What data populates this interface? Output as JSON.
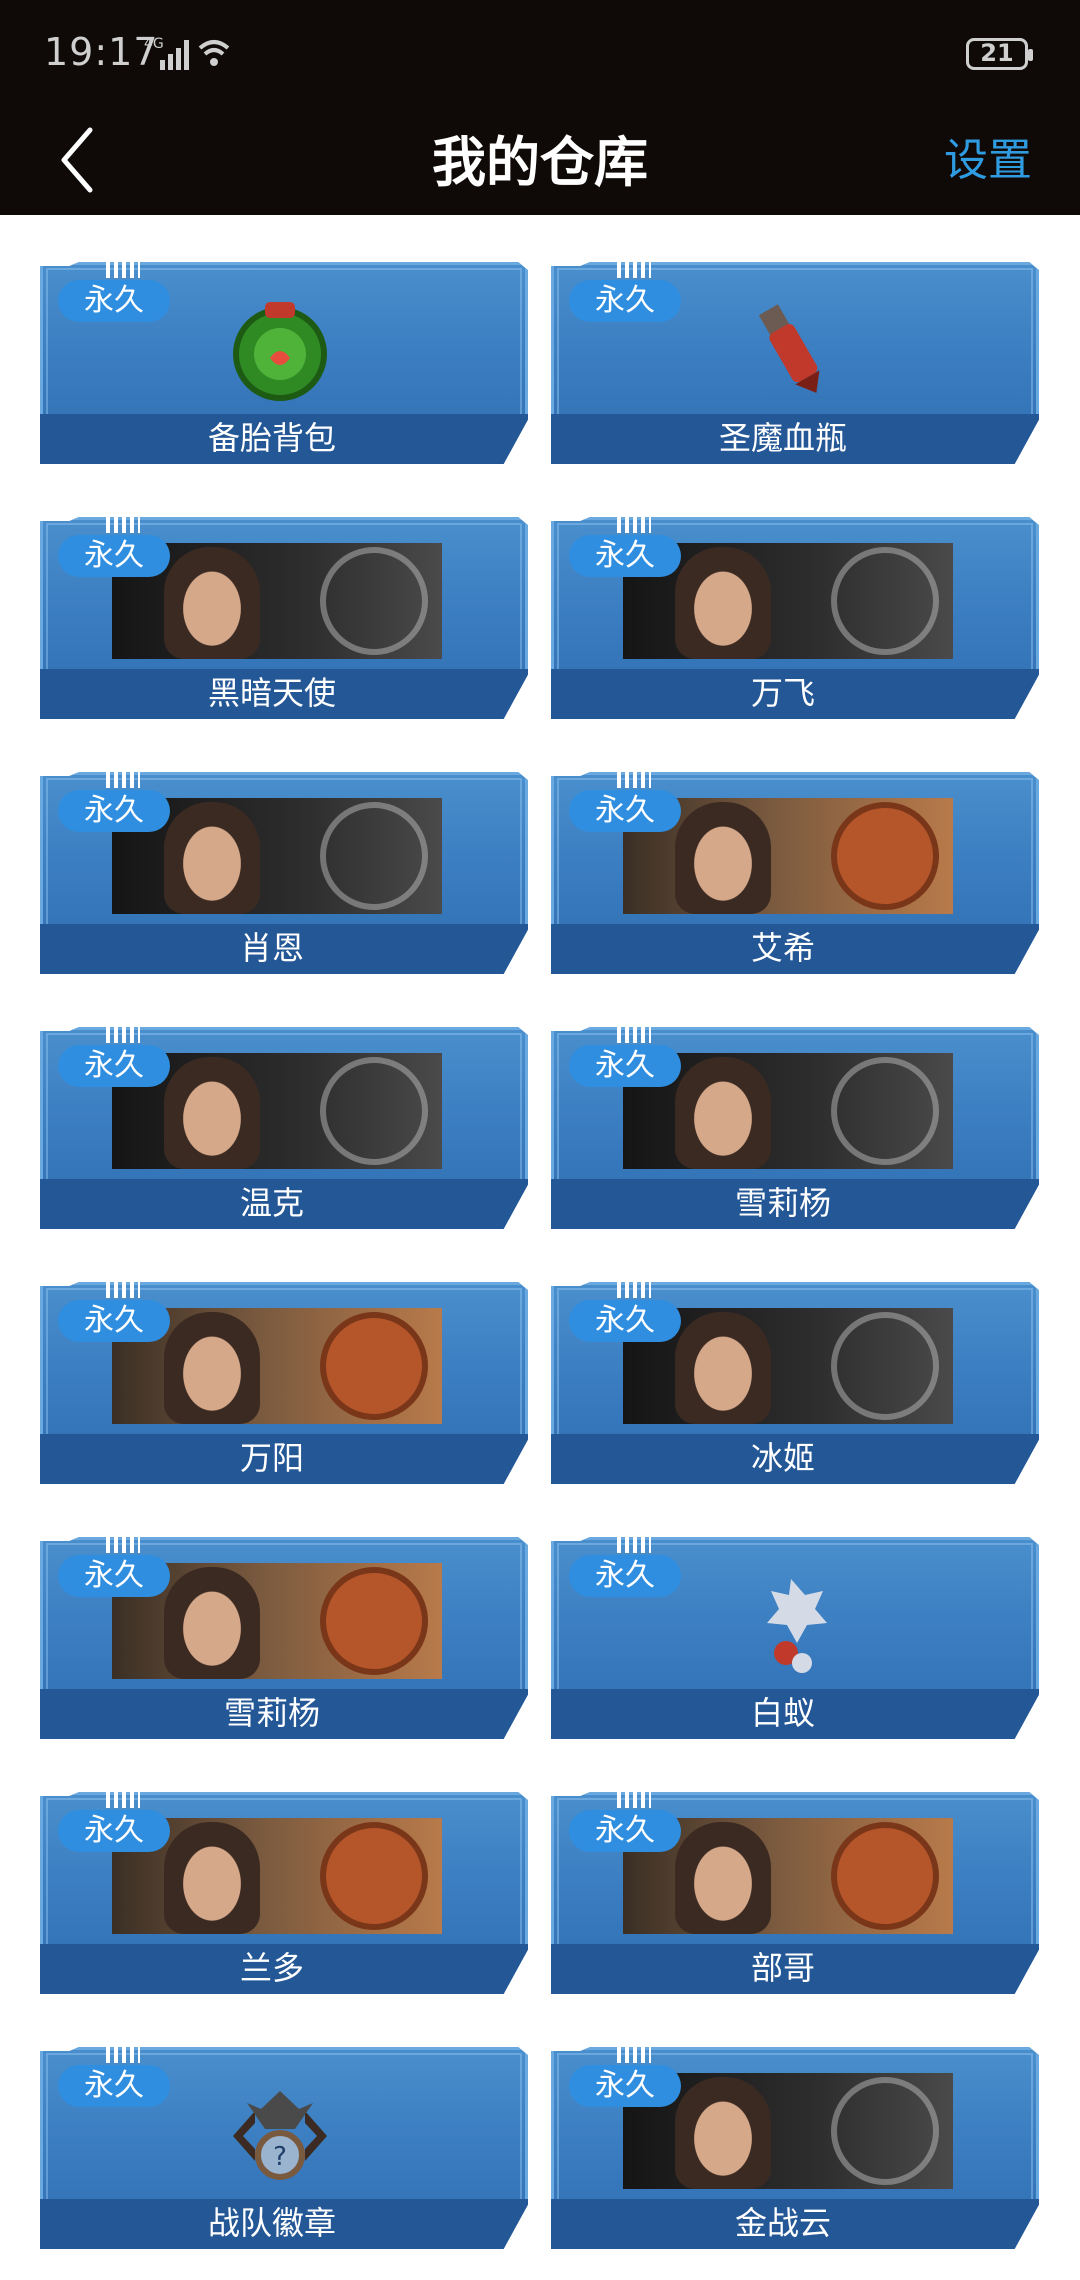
{
  "status_bar": {
    "time": "19:17",
    "network": "4G",
    "battery": "21"
  },
  "header": {
    "title": "我的仓库",
    "settings_label": "设置"
  },
  "colors": {
    "accent": "#2f9be0",
    "badge": "#2f8ee0",
    "card_blue": "#3b7ec1"
  },
  "items": [
    {
      "badge": "永久",
      "name": "备胎背包",
      "art": "green-bag-icon"
    },
    {
      "badge": "永久",
      "name": "圣魔血瓶",
      "art": "blood-vial-icon"
    },
    {
      "badge": "永久",
      "name": "黑暗天使",
      "art": "character-portrait"
    },
    {
      "badge": "永久",
      "name": "万飞",
      "art": "character-portrait"
    },
    {
      "badge": "永久",
      "name": "肖恩",
      "art": "character-portrait"
    },
    {
      "badge": "永久",
      "name": "艾希",
      "art": "character-portrait"
    },
    {
      "badge": "永久",
      "name": "温克",
      "art": "character-portrait"
    },
    {
      "badge": "永久",
      "name": "雪莉杨",
      "art": "character-portrait"
    },
    {
      "badge": "永久",
      "name": "万阳",
      "art": "character-portrait"
    },
    {
      "badge": "永久",
      "name": "冰姬",
      "art": "character-portrait"
    },
    {
      "badge": "永久",
      "name": "雪莉杨",
      "art": "character-portrait"
    },
    {
      "badge": "永久",
      "name": "白蚁",
      "art": "pet-figure-icon"
    },
    {
      "badge": "永久",
      "name": "兰多",
      "art": "character-portrait"
    },
    {
      "badge": "永久",
      "name": "部哥",
      "art": "character-portrait"
    },
    {
      "badge": "永久",
      "name": "战队徽章",
      "art": "team-badge-icon"
    },
    {
      "badge": "永久",
      "name": "金战云",
      "art": "character-portrait"
    }
  ]
}
